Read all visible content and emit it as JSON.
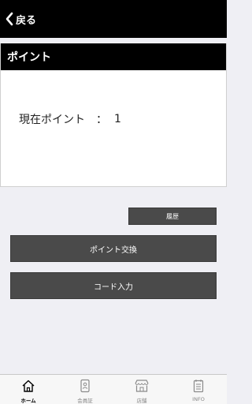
{
  "header": {
    "back_label": "戻る"
  },
  "points_card": {
    "title": "ポイント",
    "label": "現在ポイント",
    "separator": "：",
    "value": "1"
  },
  "actions": {
    "history_label": "履歴",
    "exchange_label": "ポイント交換",
    "code_label": "コード入力"
  },
  "tabbar": {
    "items": [
      {
        "label": "ホーム",
        "icon": "home-icon",
        "active": true
      },
      {
        "label": "会員証",
        "icon": "member-card-icon",
        "active": false
      },
      {
        "label": "店舗",
        "icon": "store-icon",
        "active": false
      },
      {
        "label": "INFO",
        "icon": "info-list-icon",
        "active": false
      }
    ]
  },
  "colors": {
    "header_bg": "#000000",
    "button_bg": "#4a4a4a",
    "page_bg": "#efeff4"
  }
}
